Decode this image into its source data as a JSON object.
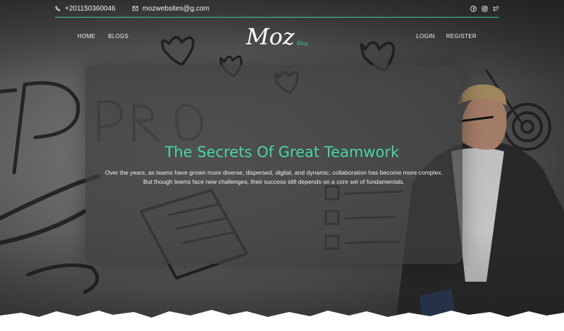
{
  "contact": {
    "phone": "+201150360046",
    "email": "mozwebsites@g.com"
  },
  "social": [
    "facebook-icon",
    "instagram-icon",
    "twitter-icon"
  ],
  "nav": {
    "home": "HOME",
    "blogs": "BLOGS",
    "login": "LOGIN",
    "register": "REGISTER"
  },
  "logo": {
    "main": "Moz",
    "sub": "Blog"
  },
  "hero": {
    "title": "The Secrets Of Great Teamwork",
    "line1": "Over the years, as teams have grown more diverse, dispersed, digital, and dynamic, collaboration has become more complex.",
    "line2": "But though teams face new challenges, their success still depends on a core set of fundamentals."
  },
  "colors": {
    "accent": "#45c99a",
    "title": "#49d6a6",
    "text": "#f0f0f0"
  }
}
